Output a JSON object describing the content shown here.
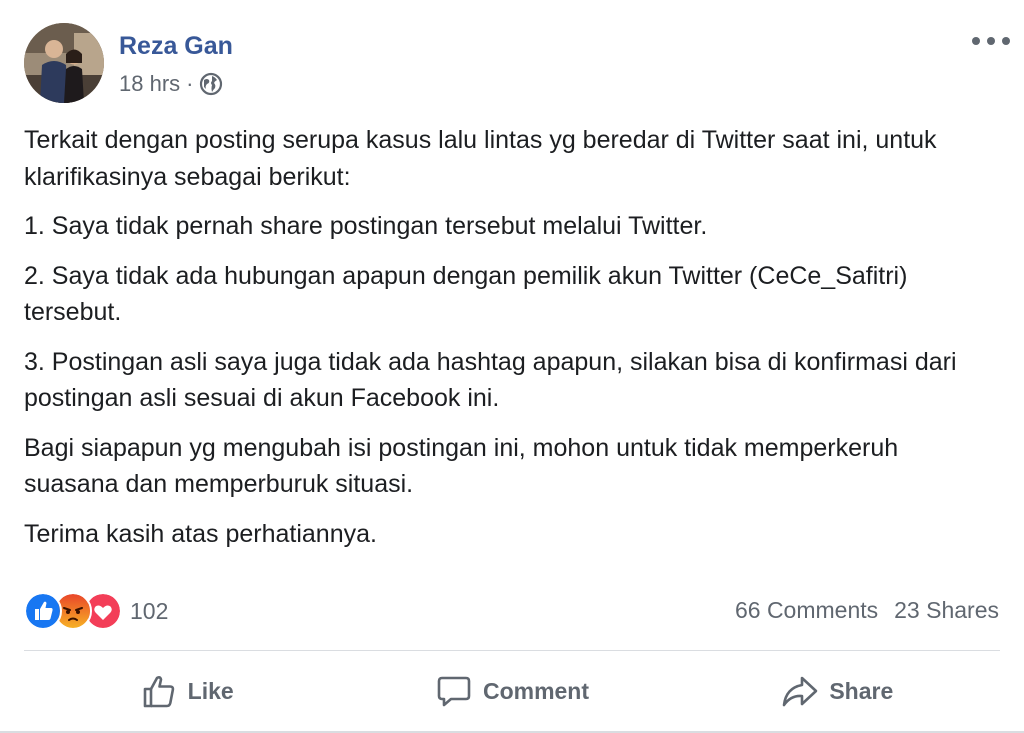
{
  "post": {
    "author": "Reza Gan",
    "time": "18 hrs",
    "separator": "·",
    "privacy_icon": "globe-icon",
    "paragraphs": [
      "Terkait dengan posting serupa kasus lalu lintas yg beredar di Twitter saat ini, untuk klarifikasinya sebagai berikut:",
      "1. Saya tidak pernah share postingan tersebut melalui Twitter.",
      "2. Saya tidak ada hubungan apapun dengan pemilik akun Twitter (CeCe_Safitri) tersebut.",
      "3. Postingan asli saya juga tidak ada hashtag apapun, silakan bisa di konfirmasi dari postingan asli sesuai di akun Facebook ini.",
      "Bagi siapapun yg mengubah isi postingan ini, mohon untuk tidak memperkeruh suasana dan memperburuk situasi.",
      "Terima kasih atas perhatiannya."
    ]
  },
  "reactions": {
    "icons": [
      "like-reaction-icon",
      "angry-reaction-icon",
      "love-reaction-icon"
    ],
    "count": "102"
  },
  "stats": {
    "comments": "66 Comments",
    "shares": "23 Shares"
  },
  "actions": {
    "like": "Like",
    "comment": "Comment",
    "share": "Share"
  },
  "colors": {
    "author_link": "#385898",
    "secondary_text": "#606770",
    "like_blue": "#1877f2",
    "angry_orange": "#e9710f",
    "love_red": "#f33e58",
    "divider": "#dadde1"
  }
}
